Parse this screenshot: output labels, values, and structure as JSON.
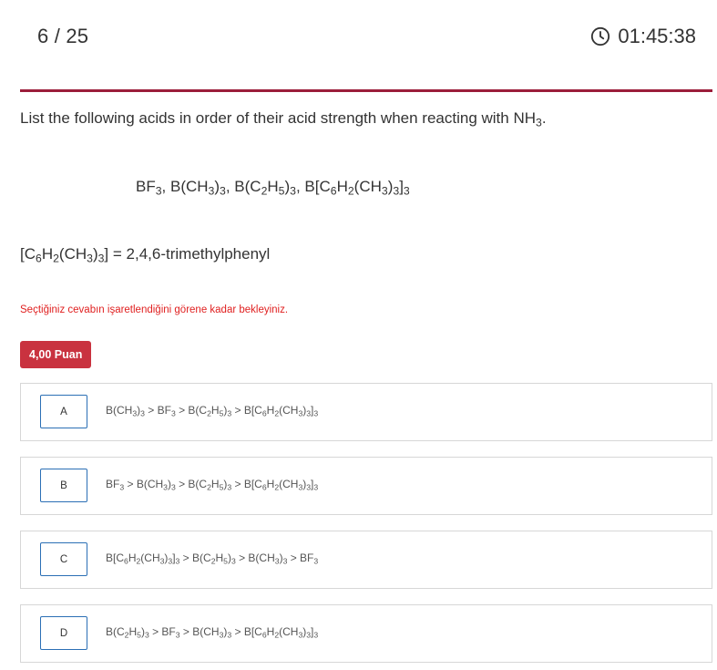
{
  "header": {
    "counter": "6 / 25",
    "timer": "01:45:38"
  },
  "question": {
    "text": "List the following acids in order of their acid strength when reacting with NH₃.",
    "formula_list": "BF₃, B(CH₃)₃, B(C₂H₅)₃, B[C₆H₂(CH₃)₃]₃",
    "definition": "[C₆H₂(CH₃)₃] = 2,4,6-trimethylphenyl"
  },
  "warning": "Seçtiğiniz cevabın işaretlendiğini görene kadar bekleyiniz.",
  "points_badge": "4,00 Puan",
  "options": [
    {
      "letter": "A",
      "text": "B(CH₃)₃ > BF₃ > B(C₂H₅)₃ > B[C₆H₂(CH₃)₃]₃"
    },
    {
      "letter": "B",
      "text": "BF₃ > B(CH₃)₃ > B(C₂H₅)₃ > B[C₆H₂(CH₃)₃]₃"
    },
    {
      "letter": "C",
      "text": "B[C₆H₂(CH₃)₃]₃ > B(C₂H₅)₃ > B(CH₃)₃ > BF₃"
    },
    {
      "letter": "D",
      "text": "B(C₂H₅)₃ > BF₃ > B(CH₃)₃ > B[C₆H₂(CH₃)₃]₃"
    }
  ],
  "colors": {
    "divider": "#9b1d3a",
    "badge_background": "#c9323f",
    "warning_text": "#e02020",
    "option_border": "#d7d7d7",
    "letter_box_border": "#2b6fb5"
  },
  "icons": {
    "timer": "clock-icon"
  }
}
